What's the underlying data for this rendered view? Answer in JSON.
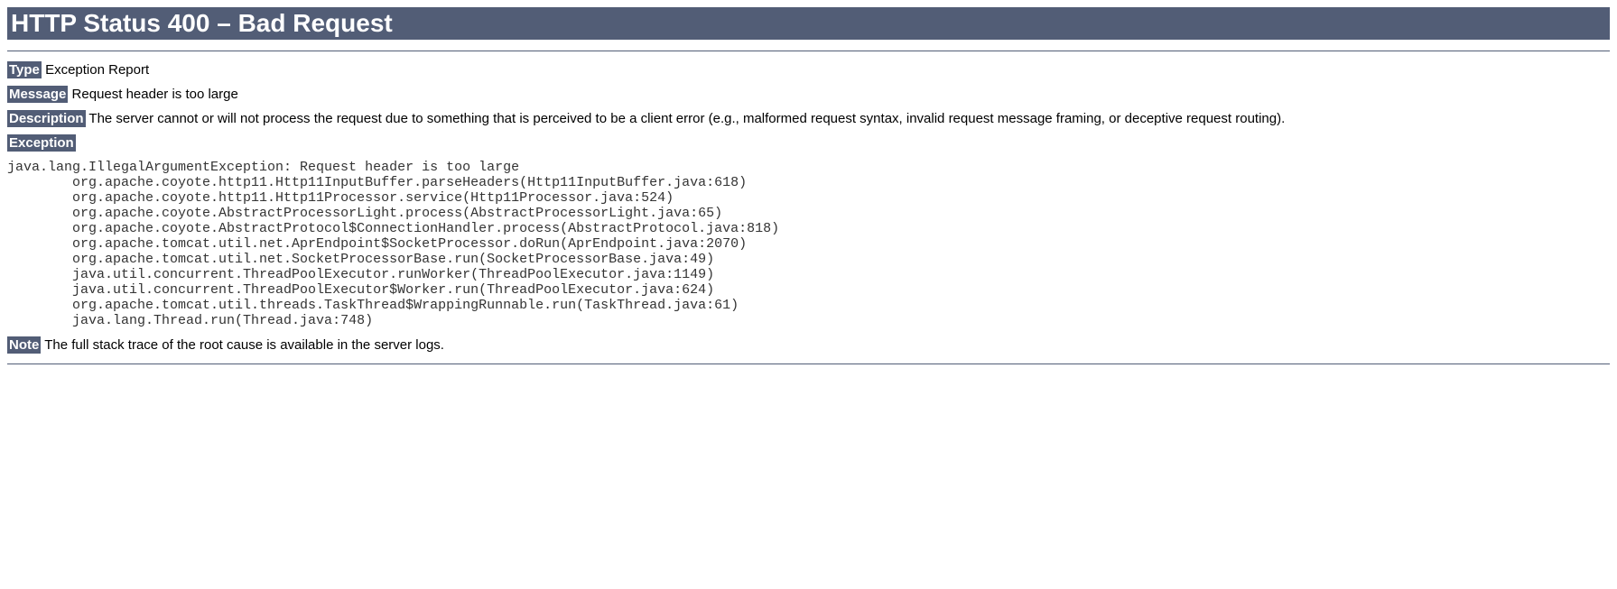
{
  "title": "HTTP Status 400 – Bad Request",
  "fields": {
    "type": {
      "label": "Type",
      "value": "Exception Report"
    },
    "message": {
      "label": "Message",
      "value": "Request header is too large"
    },
    "description": {
      "label": "Description",
      "value": "The server cannot or will not process the request due to something that is perceived to be a client error (e.g., malformed request syntax, invalid request message framing, or deceptive request routing)."
    }
  },
  "exception": {
    "heading": "Exception",
    "stacktrace": "java.lang.IllegalArgumentException: Request header is too large\n\torg.apache.coyote.http11.Http11InputBuffer.parseHeaders(Http11InputBuffer.java:618)\n\torg.apache.coyote.http11.Http11Processor.service(Http11Processor.java:524)\n\torg.apache.coyote.AbstractProcessorLight.process(AbstractProcessorLight.java:65)\n\torg.apache.coyote.AbstractProtocol$ConnectionHandler.process(AbstractProtocol.java:818)\n\torg.apache.tomcat.util.net.AprEndpoint$SocketProcessor.doRun(AprEndpoint.java:2070)\n\torg.apache.tomcat.util.net.SocketProcessorBase.run(SocketProcessorBase.java:49)\n\tjava.util.concurrent.ThreadPoolExecutor.runWorker(ThreadPoolExecutor.java:1149)\n\tjava.util.concurrent.ThreadPoolExecutor$Worker.run(ThreadPoolExecutor.java:624)\n\torg.apache.tomcat.util.threads.TaskThread$WrappingRunnable.run(TaskThread.java:61)\n\tjava.lang.Thread.run(Thread.java:748)"
  },
  "note": {
    "label": "Note",
    "value": "The full stack trace of the root cause is available in the server logs."
  }
}
